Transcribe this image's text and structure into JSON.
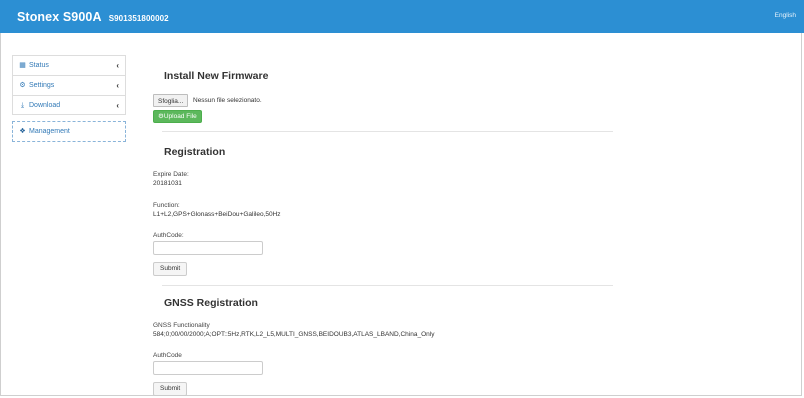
{
  "header": {
    "brand": "Stonex S900A",
    "serial": "S901351800002",
    "language": "English"
  },
  "sidebar": {
    "items": [
      {
        "label": "Status",
        "icon": "grid-icon"
      },
      {
        "label": "Settings",
        "icon": "gear-icon"
      },
      {
        "label": "Download",
        "icon": "download-icon"
      },
      {
        "label": "Management",
        "icon": "info-icon"
      }
    ]
  },
  "firmware": {
    "title": "Install New Firmware",
    "browse_label": "Sfoglia...",
    "no_file_text": "Nessun file selezionato.",
    "upload_label": "Upload File"
  },
  "registration": {
    "title": "Registration",
    "expire_label": "Expire Date:",
    "expire_value": "20181031",
    "function_label": "Function:",
    "function_value": "L1+L2,GPS+Glonass+BeiDou+Galileo,50Hz",
    "authcode_label": "AuthCode:",
    "authcode_value": "",
    "submit_label": "Submit"
  },
  "gnss": {
    "title": "GNSS Registration",
    "functionality_label": "GNSS Functionality",
    "functionality_value": "584;0;00/00/2000;A;OPT::5Hz,RTK,L2_L5,MULTI_GNSS,BEIDOUB3,ATLAS_LBAND,China_Only",
    "authcode_label": "AuthCode",
    "authcode_value": "",
    "submit_label": "Submit"
  },
  "colors": {
    "topbar": "#2c8fd3",
    "link": "#337ab7",
    "upload_button": "#5cb85c"
  }
}
